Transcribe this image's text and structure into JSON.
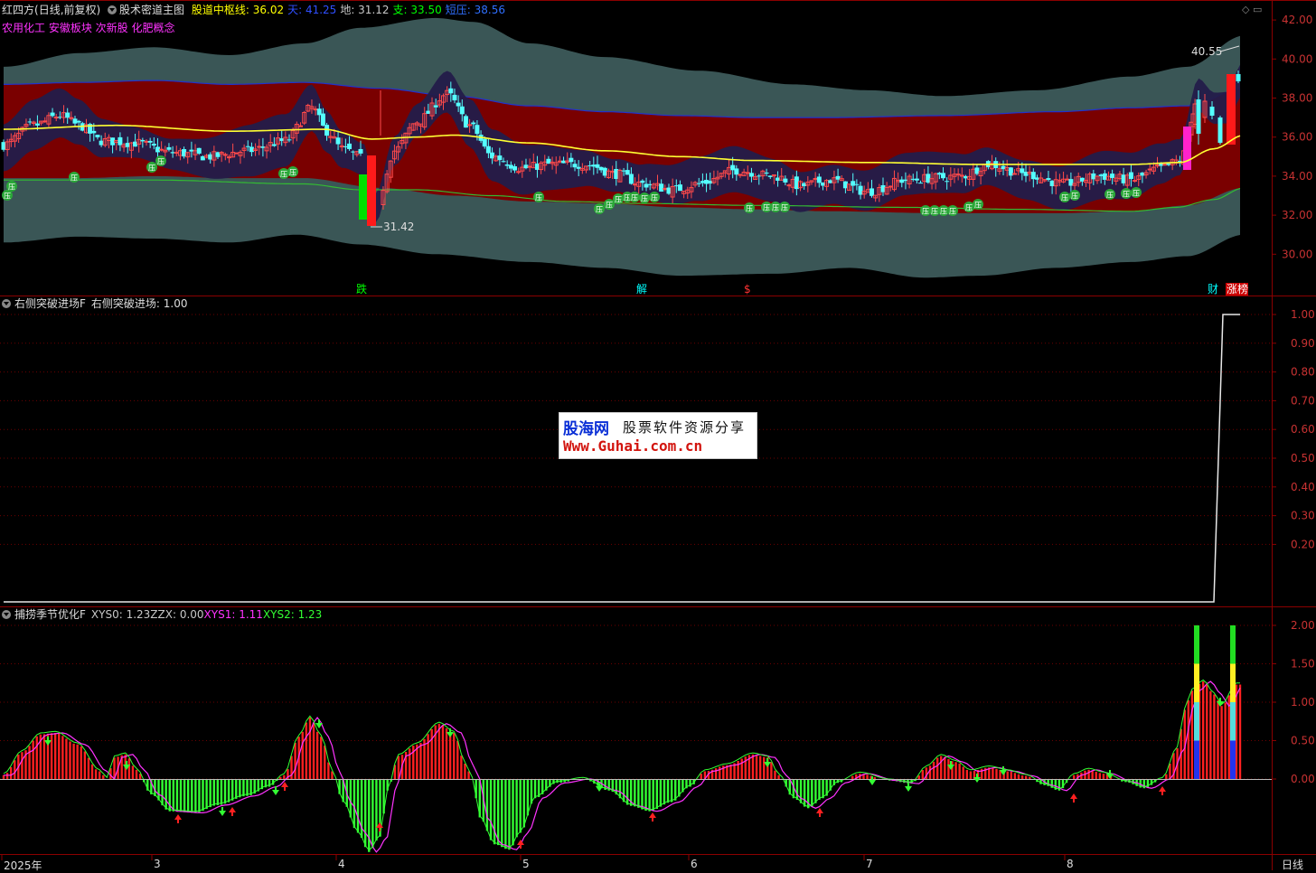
{
  "header": {
    "stock": "红四方",
    "period": "(日线,前复权)",
    "indicator": "股术密道主图",
    "items": [
      {
        "label": "股道中枢线:",
        "value": "36.02",
        "color": "#ffff00"
      },
      {
        "label": "天:",
        "value": "41.25",
        "color": "#2f4fff"
      },
      {
        "label": "地:",
        "value": "31.12",
        "color": "#c8c8c8"
      },
      {
        "label": "支:",
        "value": "33.50",
        "color": "#00ff00"
      },
      {
        "label": "短压:",
        "value": "38.56",
        "color": "#2f6fff"
      }
    ],
    "concepts": "农用化工 安徽板块 次新股 化肥概念",
    "concept_color": "#ff33ff"
  },
  "main_panel": {
    "y_ticks": [
      "42.00",
      "40.00",
      "38.00",
      "36.00",
      "34.00",
      "32.00",
      "30.00"
    ],
    "high_label": "40.55",
    "low_label": "31.42",
    "pressure_marker": "压",
    "events": [
      {
        "text": "跌",
        "color": "#00ff00"
      },
      {
        "text": "解",
        "color": "#00ffff"
      },
      {
        "text": "$",
        "color": "#ff3333"
      },
      {
        "text": "财",
        "color": "#00ffff"
      },
      {
        "text": "涨",
        "color": "#ffffff",
        "bg": "#cc0000"
      },
      {
        "text": "榜",
        "color": "#ffffff",
        "bg": "#cc0000"
      }
    ]
  },
  "panel2": {
    "title": "右侧突破进场F",
    "value_label": "右侧突破进场:",
    "value": "1.00",
    "y_ticks": [
      "1.00",
      "0.90",
      "0.80",
      "0.70",
      "0.60",
      "0.50",
      "0.40",
      "0.30",
      "0.20"
    ]
  },
  "panel3": {
    "title": "捕捞季节优化F",
    "items": [
      {
        "label": "XYS0:",
        "value": "1.23",
        "color": "#c8c8c8"
      },
      {
        "label": "ZZX:",
        "value": "0.00",
        "color": "#c8c8c8"
      },
      {
        "label": "XYS1:",
        "value": "1.11",
        "color": "#ff33ff"
      },
      {
        "label": "XYS2:",
        "value": "1.23",
        "color": "#33ff33"
      }
    ],
    "y_ticks": [
      "2.00",
      "1.50",
      "1.00",
      "0.50",
      "0.00"
    ]
  },
  "x_axis": {
    "labels": [
      "2025年",
      "3",
      "4",
      "5",
      "6",
      "7",
      "8"
    ],
    "period_button": "日线"
  },
  "watermark": {
    "brand": "股海网",
    "slogan": "股票软件资源分享",
    "url": "Www.Guhai.com.cn"
  }
}
